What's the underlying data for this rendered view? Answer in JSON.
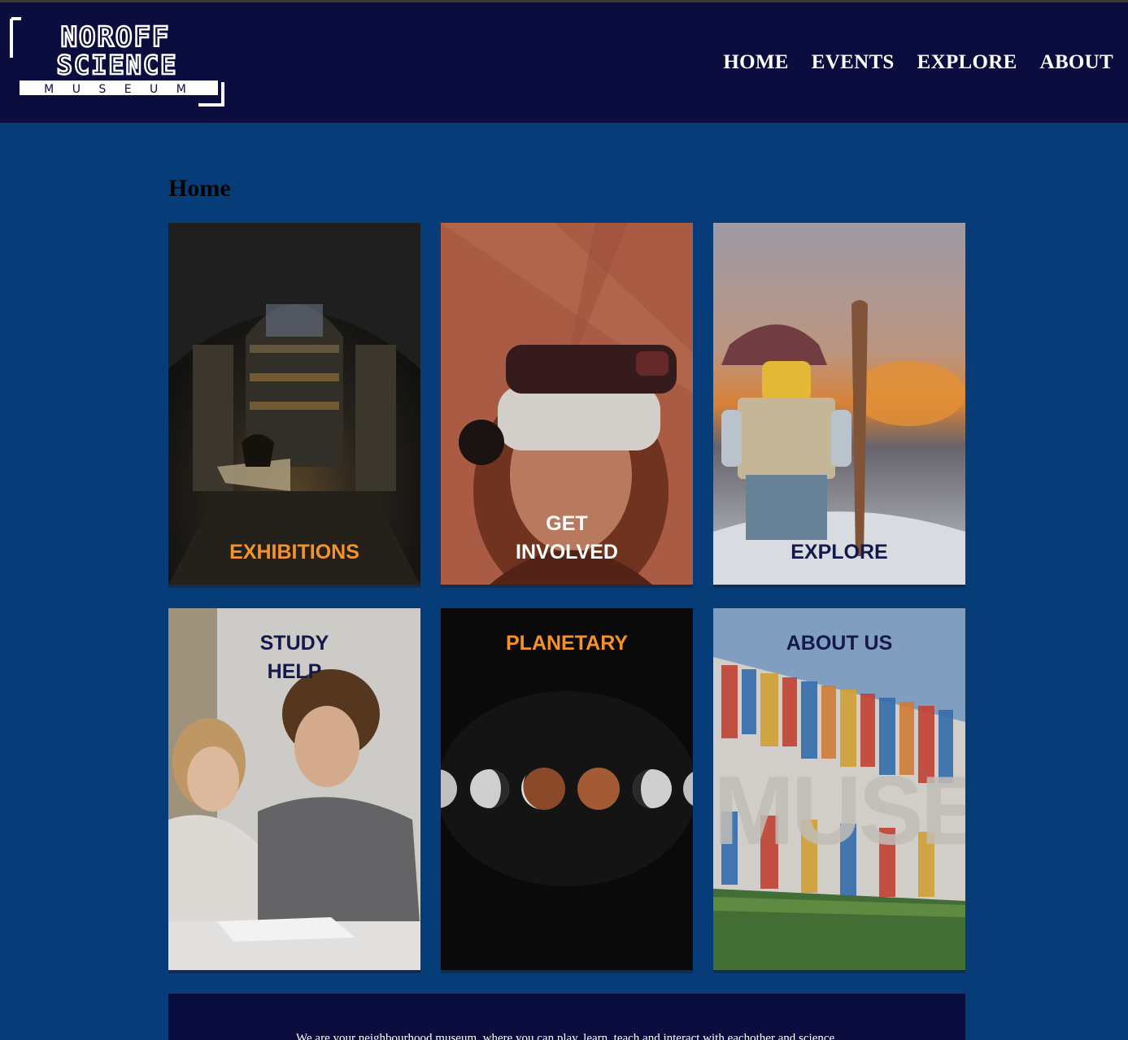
{
  "header": {
    "logo": {
      "line1": "NOROFF",
      "line2": "SCIENCE",
      "line3": "M U S E U M"
    },
    "nav": [
      {
        "label": "HOME"
      },
      {
        "label": "EVENTS"
      },
      {
        "label": "EXPLORE"
      },
      {
        "label": "ABOUT"
      }
    ]
  },
  "main": {
    "title": "Home",
    "cards": [
      {
        "label": "EXHIBITIONS",
        "color": "#f5922a",
        "image": "museum-hall-image"
      },
      {
        "label": "GET\nINVOLVED",
        "color": "#ffffff",
        "image": "vr-headset-image"
      },
      {
        "label": "EXPLORE",
        "color": "#15184a",
        "image": "lego-explorer-image"
      },
      {
        "label": "STUDY\nHELP",
        "color": "#15184a",
        "image": "students-studying-image"
      },
      {
        "label": "PLANETARY",
        "color": "#f5922a",
        "image": "lunar-phases-image"
      },
      {
        "label": "ABOUT US",
        "color": "#15184a",
        "image": "museum-facade-image"
      }
    ]
  },
  "footer": {
    "text": "We are your neighbourhood museum, where you can play, learn, teach and interact with eachother and science."
  },
  "colors": {
    "header_bg": "#0c0d3f",
    "page_bg": "#063c78",
    "accent_orange": "#f5922a",
    "dark_navy_text": "#15184a"
  }
}
